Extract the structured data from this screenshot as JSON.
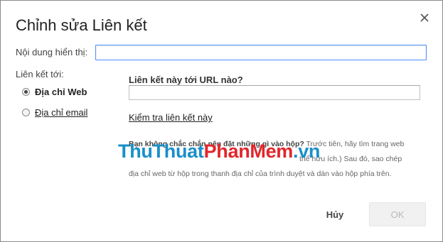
{
  "dialog": {
    "title": "Chỉnh sửa Liên kết",
    "close_icon": "close-icon"
  },
  "form": {
    "display_text_label": "Nội dung hiển thị:",
    "display_text_value": "",
    "link_to_label": "Liên kết tới:",
    "options": [
      {
        "label": "Địa chỉ Web",
        "selected": true
      },
      {
        "label": "Địa chỉ email",
        "selected": false
      }
    ],
    "url_question": "Liên kết này tới URL nào?",
    "url_value": "",
    "test_link": "Kiểm tra liên kết này"
  },
  "help": {
    "bold": "Bạn không chắc chắn nên đặt những gì vào hộp?",
    "text1": " Trước tiên, hãy tìm trang web",
    "line2_visible": "thể hữu ích.) Sau đó, sao chép",
    "line3": "địa chỉ web từ hộp trong thanh địa chỉ của trình duyệt và dán vào hộp phía trên."
  },
  "watermark": {
    "part1": "ThuThuat",
    "part2": "PhanMem",
    "part3": ".vn"
  },
  "buttons": {
    "cancel": "Hủy",
    "ok": "OK"
  },
  "colors": {
    "focus_border": "#4d90fe",
    "watermark_blue": "#1a8fc9",
    "watermark_red": "#e1262b"
  }
}
